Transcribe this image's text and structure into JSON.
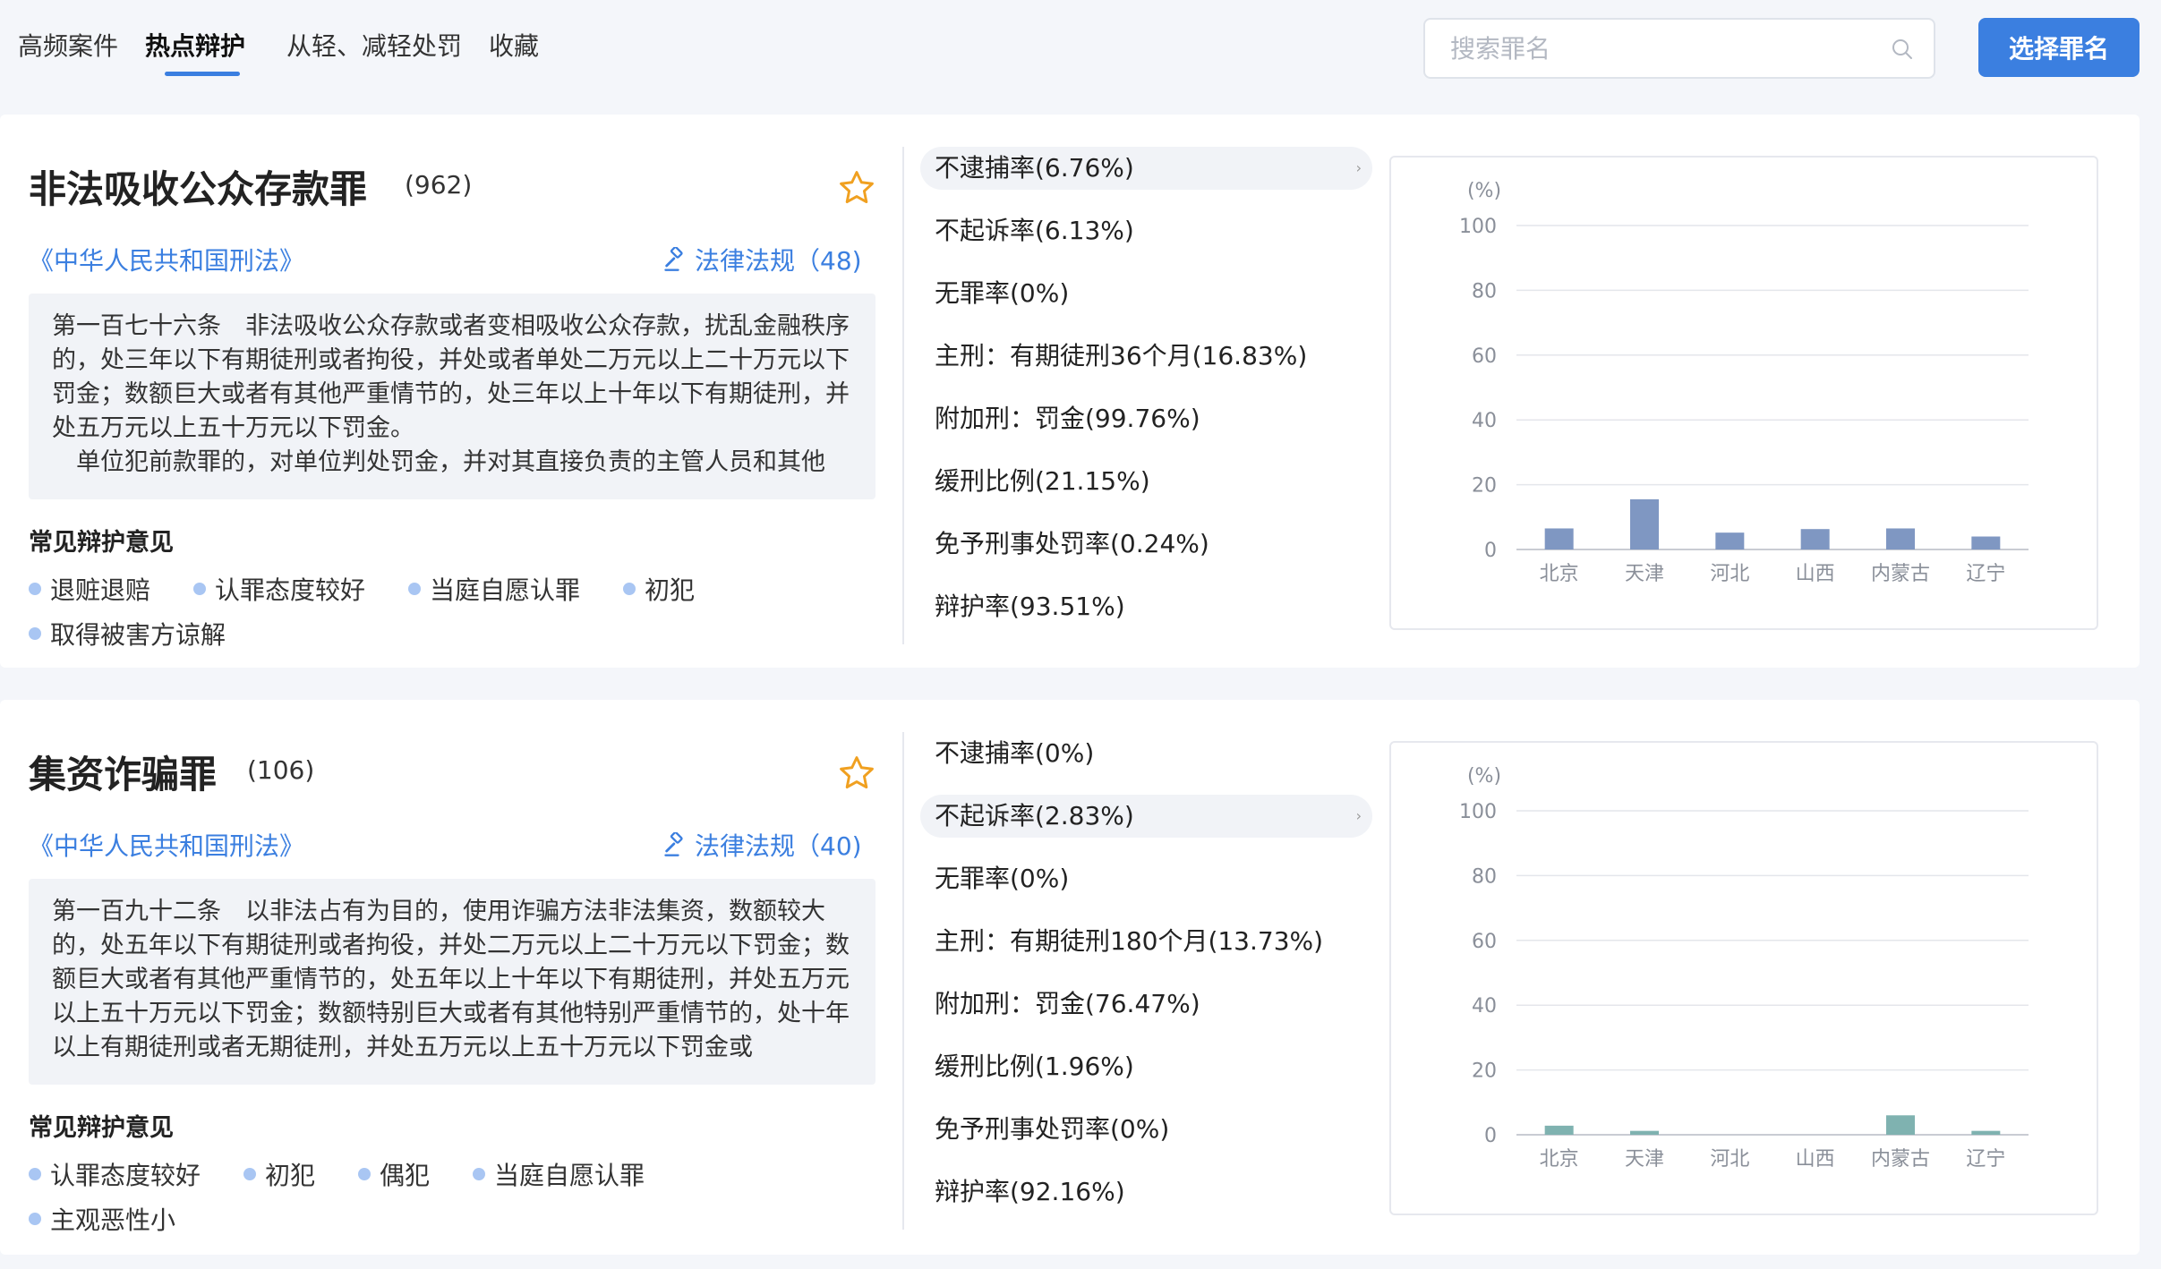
{
  "tabs": [
    {
      "label": "高频案件",
      "active": false
    },
    {
      "label": "热点辩护",
      "active": true
    },
    {
      "label": "从轻、减轻处罚",
      "active": false
    },
    {
      "label": "收藏",
      "active": false
    }
  ],
  "search": {
    "placeholder": "搜索罪名",
    "value": ""
  },
  "select_button": "选择罪名",
  "colors": {
    "accent": "#3b7fe0",
    "bar_card1": "#7f97c2",
    "bar_card2": "#7fb2b0"
  },
  "cards": [
    {
      "title": "非法吸收公众存款罪",
      "count": "(962)",
      "law_title": "《中华人民共和国刑法》",
      "regulations": "法律法规（48)",
      "law_paragraphs": [
        "第一百七十六条　非法吸收公众存款或者变相吸收公众存款，扰乱金融秩序的，处三年以下有期徒刑或者拘役，并处或者单处二万元以上二十万元以下罚金；数额巨大或者有其他严重情节的，处三年以上十年以下有期徒刑，并处五万元以上五十万元以下罚金。",
        "　单位犯前款罪的，对单位判处罚金，并对其直接负责的主管人员和其他"
      ],
      "opinion_heading": "常见辩护意见",
      "opinions": [
        "退赃退赔",
        "认罪态度较好",
        "当庭自愿认罪",
        "初犯",
        "取得被害方谅解"
      ],
      "stats": [
        {
          "label": "不逮捕率(6.76%)",
          "highlighted": true
        },
        {
          "label": "不起诉率(6.13%)",
          "highlighted": false
        },
        {
          "label": "无罪率(0%)",
          "highlighted": false
        },
        {
          "label": "主刑：有期徒刑36个月(16.83%)",
          "highlighted": false
        },
        {
          "label": "附加刑：罚金(99.76%)",
          "highlighted": false
        },
        {
          "label": "缓刑比例(21.15%)",
          "highlighted": false
        },
        {
          "label": "免予刑事处罚率(0.24%)",
          "highlighted": false
        },
        {
          "label": "辩护率(93.51%)",
          "highlighted": false
        }
      ],
      "chart_data": {
        "type": "bar",
        "ylabel": "(%)",
        "categories": [
          "北京",
          "天津",
          "河北",
          "山西",
          "内蒙古",
          "辽宁"
        ],
        "values": [
          6.5,
          15.5,
          5.2,
          6.3,
          6.5,
          4.0
        ],
        "ylim": [
          0,
          100
        ],
        "yticks": [
          0,
          20,
          40,
          60,
          80,
          100
        ],
        "grid": true
      }
    },
    {
      "title": "集资诈骗罪",
      "count": "(106)",
      "law_title": "《中华人民共和国刑法》",
      "regulations": "法律法规（40)",
      "law_paragraphs": [
        "第一百九十二条　以非法占有为目的，使用诈骗方法非法集资，数额较大的，处五年以下有期徒刑或者拘役，并处二万元以上二十万元以下罚金；数额巨大或者有其他严重情节的，处五年以上十年以下有期徒刑，并处五万元以上五十万元以下罚金；数额特别巨大或者有其他特别严重情节的，处十年以上有期徒刑或者无期徒刑，并处五万元以上五十万元以下罚金或"
      ],
      "opinion_heading": "常见辩护意见",
      "opinions": [
        "认罪态度较好",
        "初犯",
        "偶犯",
        "当庭自愿认罪",
        "主观恶性小"
      ],
      "stats": [
        {
          "label": "不逮捕率(0%)",
          "highlighted": false
        },
        {
          "label": "不起诉率(2.83%)",
          "highlighted": true
        },
        {
          "label": "无罪率(0%)",
          "highlighted": false
        },
        {
          "label": "主刑：有期徒刑180个月(13.73%)",
          "highlighted": false
        },
        {
          "label": "附加刑：罚金(76.47%)",
          "highlighted": false
        },
        {
          "label": "缓刑比例(1.96%)",
          "highlighted": false
        },
        {
          "label": "免予刑事处罚率(0%)",
          "highlighted": false
        },
        {
          "label": "辩护率(92.16%)",
          "highlighted": false
        }
      ],
      "chart_data": {
        "type": "bar",
        "ylabel": "(%)",
        "categories": [
          "北京",
          "天津",
          "河北",
          "山西",
          "内蒙古",
          "辽宁"
        ],
        "values": [
          2.8,
          1.2,
          0,
          0,
          6.0,
          1.2
        ],
        "ylim": [
          0,
          100
        ],
        "yticks": [
          0,
          20,
          40,
          60,
          80,
          100
        ],
        "grid": true
      }
    }
  ]
}
